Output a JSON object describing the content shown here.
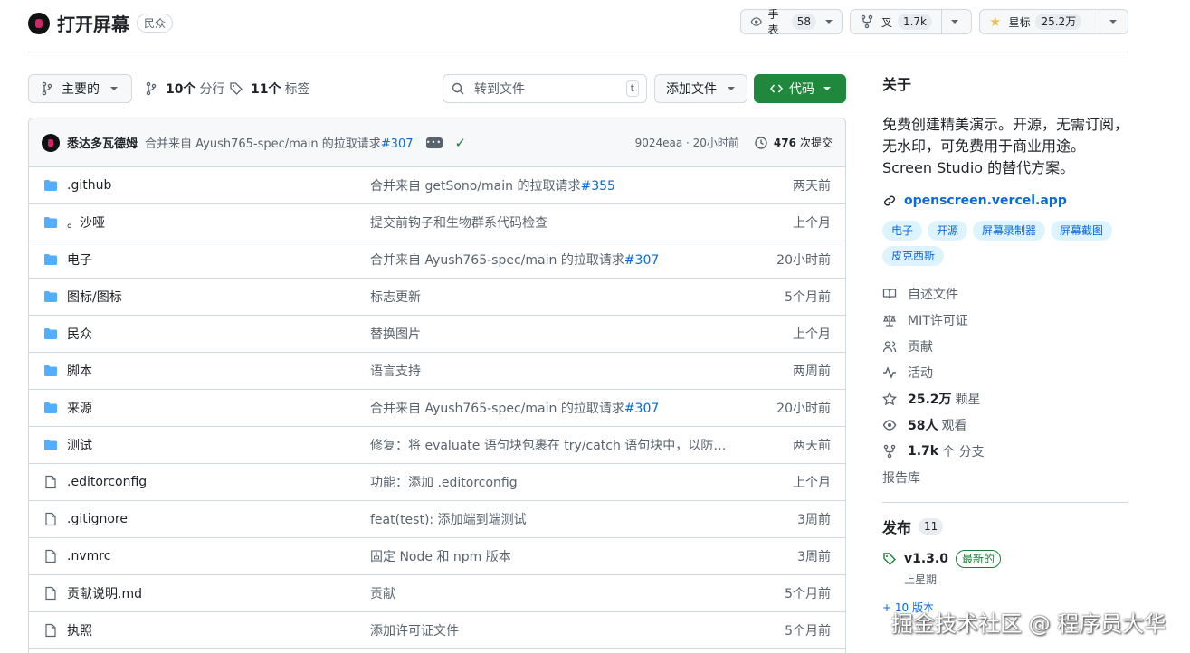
{
  "repo": {
    "name": "打开屏幕",
    "visibility": "民众"
  },
  "header_actions": {
    "watch": {
      "label": "手表",
      "count": "58"
    },
    "fork": {
      "label": "叉",
      "count": "1.7k"
    },
    "star": {
      "label": "星标",
      "count": "25.2万"
    }
  },
  "toolbar": {
    "branch_label": "主要的",
    "branches_count": "10个",
    "branches_label": "分行",
    "tags_count": "11个",
    "tags_label": "标签",
    "search_placeholder": "转到文件",
    "search_key": "t",
    "add_file_label": "添加文件",
    "code_label": "代码"
  },
  "latest_commit": {
    "author": "悉达多瓦德姆",
    "message": "合并来自 Ayush765-spec/main 的拉取请求",
    "pr": "#307",
    "hash": "9024eaa · 20小时前",
    "count": "476",
    "count_label": "次提交"
  },
  "files": [
    {
      "type": "folder",
      "name": ".github",
      "message": "合并来自 getSono/main 的拉取请求",
      "pr": "#355",
      "time": "两天前"
    },
    {
      "type": "folder",
      "name": "。沙哑",
      "message": "提交前钩子和生物群系代码检查",
      "pr": "",
      "time": "上个月"
    },
    {
      "type": "folder",
      "name": "电子",
      "message": "合并来自 Ayush765-spec/main 的拉取请求",
      "pr": "#307",
      "time": "20小时前"
    },
    {
      "type": "folder",
      "name": "图标/图标",
      "message": "标志更新",
      "pr": "",
      "time": "5个月前"
    },
    {
      "type": "folder",
      "name": "民众",
      "message": "替换图片",
      "pr": "",
      "time": "上个月"
    },
    {
      "type": "folder",
      "name": "脚本",
      "message": "语言支持",
      "pr": "",
      "time": "两周前"
    },
    {
      "type": "folder",
      "name": "来源",
      "message": "合并来自 Ayush765-spec/main 的拉取请求",
      "pr": "#307",
      "time": "20小时前"
    },
    {
      "type": "folder",
      "name": "测试",
      "message": "修复：将 evaluate 语句块包裹在 try/catch 语句块中，以防止 ...",
      "pr": "",
      "time": "两天前"
    },
    {
      "type": "file",
      "name": ".editorconfig",
      "message": "功能：添加 .editorconfig",
      "pr": "",
      "time": "上个月"
    },
    {
      "type": "file",
      "name": ".gitignore",
      "message": "feat(test): 添加端到端测试",
      "pr": "",
      "time": "3周前"
    },
    {
      "type": "file",
      "name": ".nvmrc",
      "message": "固定 Node 和 npm 版本",
      "pr": "",
      "time": "3周前"
    },
    {
      "type": "file",
      "name": "贡献说明.md",
      "message": "贡献",
      "pr": "",
      "time": "5个月前"
    },
    {
      "type": "file",
      "name": "执照",
      "message": "添加许可证文件",
      "pr": "",
      "time": "5个月前"
    }
  ],
  "about": {
    "title": "关于",
    "description": "免费创建精美演示。开源，无需订阅，无水印，可免费用于商业用途。Screen Studio 的替代方案。",
    "website": "openscreen.vercel.app",
    "topics": [
      "电子",
      "开源",
      "屏幕录制器",
      "屏幕截图",
      "皮克西斯"
    ],
    "readme": "自述文件",
    "license": "MIT许可证",
    "contributing": "贡献",
    "activity": "活动",
    "stars_count": "25.2万",
    "stars_label": "颗星",
    "watchers_count": "58人",
    "watchers_label": "观看",
    "forks_count": "1.7k",
    "forks_label": "个 分支",
    "report": "报告库"
  },
  "releases": {
    "title": "发布",
    "count": "11",
    "latest_version": "v1.3.0",
    "latest_badge": "最新的",
    "latest_date": "上星期",
    "more": "+ 10 版本"
  },
  "watermark": "掘金技术社区 @ 程序员大华",
  "colors": {
    "primary_green": "#1f883d",
    "link_blue": "#0969da",
    "folder_blue": "#54aeff",
    "border": "#d1d9e0",
    "muted": "#59636e"
  }
}
